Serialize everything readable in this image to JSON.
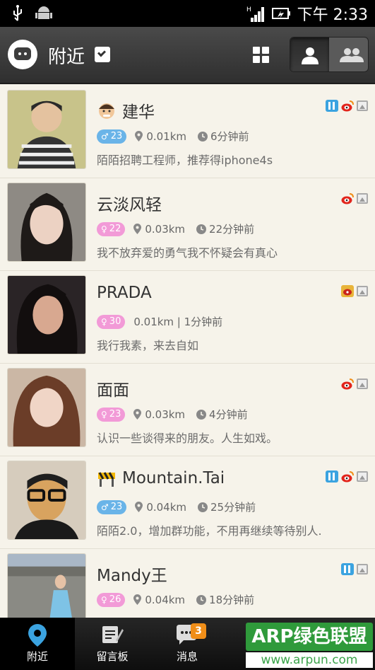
{
  "status_bar": {
    "time": "下午 2:33",
    "icons": [
      "usb-icon",
      "android-debug-icon",
      "signal-icon",
      "battery-charging-icon"
    ]
  },
  "header": {
    "title": "附近",
    "icons": [
      "app-logo-icon",
      "dropdown-icon",
      "grid-view-icon",
      "single-user-icon",
      "group-icon"
    ]
  },
  "users": [
    {
      "name": "建华",
      "gender": "male",
      "age": "23",
      "distance": "0.01km",
      "time": "6分钟前",
      "signature": "陌陌招聘工程师，推荐得iphone4s",
      "badges": [
        "it",
        "weibo",
        "photo"
      ],
      "name_badge": "face"
    },
    {
      "name": "云淡风轻",
      "gender": "female",
      "age": "22",
      "distance": "0.03km",
      "time": "22分钟前",
      "signature": "我不放弃爱的勇气我不怀疑会有真心",
      "badges": [
        "weibo",
        "photo"
      ],
      "name_badge": ""
    },
    {
      "name": "PRADA",
      "gender": "female",
      "age": "30",
      "distance": "0.01km",
      "time": "1分钟前",
      "signature": "我行我素，来去自如",
      "badges": [
        "weibo-gold",
        "photo"
      ],
      "name_badge": "",
      "compact_meta": "0.01km | 1分钟前"
    },
    {
      "name": "面面",
      "gender": "female",
      "age": "23",
      "distance": "0.03km",
      "time": "4分钟前",
      "signature": "认识一些谈得来的朋友。人生如戏。",
      "badges": [
        "weibo",
        "photo"
      ],
      "name_badge": ""
    },
    {
      "name": "Mountain.Tai",
      "gender": "male",
      "age": "23",
      "distance": "0.04km",
      "time": "25分钟前",
      "signature": "陌陌2.0，增加群功能，不用再继续等待别人.",
      "badges": [
        "it",
        "weibo",
        "photo"
      ],
      "name_badge": "barrier"
    },
    {
      "name": "Mandy王",
      "gender": "female",
      "age": "26",
      "distance": "0.04km",
      "time": "18分钟前",
      "signature": "",
      "badges": [
        "it",
        "photo"
      ],
      "name_badge": ""
    }
  ],
  "tabs": [
    {
      "label": "附近",
      "icon": "location-pin-icon",
      "active": true
    },
    {
      "label": "留言板",
      "icon": "notepad-icon",
      "active": false
    },
    {
      "label": "消息",
      "icon": "chat-bubble-icon",
      "active": false,
      "badge": "3"
    }
  ],
  "watermark": {
    "top": "ARP绿色联盟",
    "bottom": "www.arpun.com"
  },
  "colors": {
    "male": "#6ab4e8",
    "female": "#f29ad7",
    "badge_orange": "#f08e18",
    "watermark_green": "#2f9a3b"
  }
}
